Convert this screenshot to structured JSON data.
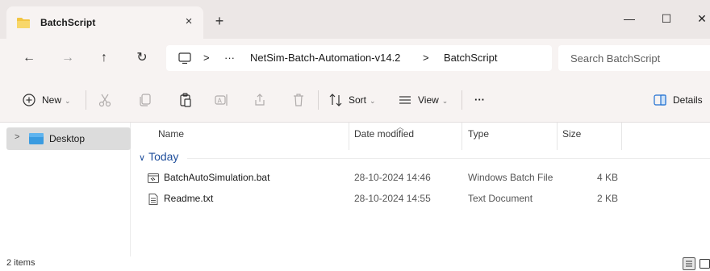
{
  "window": {
    "tab_title": "BatchScript",
    "tab_close": "×",
    "new_tab": "+",
    "minimize": "—",
    "maximize": "☐",
    "close": "✕"
  },
  "navigation": {
    "back": "←",
    "forward": "→",
    "up": "↑",
    "refresh": "↻",
    "breadcrumb_sep1": ">",
    "ellipsis": "···",
    "crumb_parent": "NetSim-Batch-Automation-v14.2",
    "breadcrumb_sep2": ">",
    "crumb_current": "BatchScript",
    "search_placeholder": "Search BatchScript"
  },
  "toolbar": {
    "new_label": "New",
    "sort_label": "Sort",
    "view_label": "View",
    "more_label": "···",
    "details_label": "Details"
  },
  "sidebar": {
    "items": [
      {
        "label": "Desktop",
        "expander": ">"
      }
    ]
  },
  "file_list": {
    "columns": {
      "name": "Name",
      "date_modified": "Date modified",
      "type": "Type",
      "size": "Size"
    },
    "groups": [
      {
        "label": "Today",
        "files": [
          {
            "name": "BatchAutoSimulation.bat",
            "date_modified": "28-10-2024 14:46",
            "type": "Windows Batch File",
            "size": "4 KB",
            "icon": "batch-file-icon"
          },
          {
            "name": "Readme.txt",
            "date_modified": "28-10-2024 14:55",
            "type": "Text Document",
            "size": "2 KB",
            "icon": "text-file-icon"
          }
        ]
      }
    ]
  },
  "status": {
    "item_count": "2 items"
  },
  "colors": {
    "folder": "#f2c542",
    "accent": "#1f4e9b",
    "desktop_icon": "#3a9be0"
  }
}
